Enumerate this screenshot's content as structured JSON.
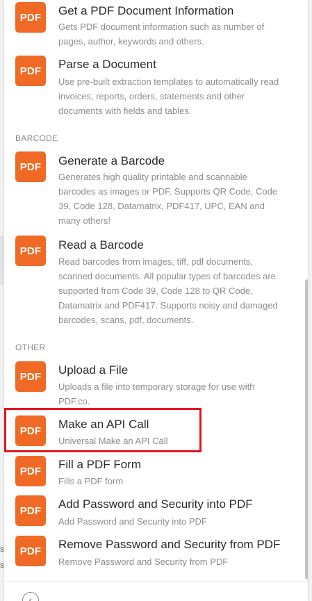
{
  "icon_label": "PDF",
  "colors": {
    "accent": "#f06a25",
    "highlight": "#e3141e"
  },
  "sections": {
    "barcode": "BARCODE",
    "other": "OTHER"
  },
  "items": [
    {
      "title": "Get a PDF Document Information",
      "description": "Gets PDF document information such as number of pages, author, keywords and others."
    },
    {
      "title": "Parse a Document",
      "description": "Use pre-built extraction templates to automatically read invoices, reports, orders, statements and other documents with fields and tables."
    },
    {
      "title": "Generate a Barcode",
      "description": "Generates high quality printable and scannable barcodes as images or PDF. Supports QR Code, Code 39, Code 128, Datamatrix, PDF417, UPC, EAN and many others!"
    },
    {
      "title": "Read a Barcode",
      "description": "Read barcodes from images, tiff, pdf documents, scanned documents. All popular types of barcodes are supported from Code 39, Code 128 to QR Code, Datamatrix and PDF417. Supports noisy and damaged barcodes, scans, pdf, documents."
    },
    {
      "title": "Upload a File",
      "description": "Uploads a file into temporary storage for use with PDF.co."
    },
    {
      "title": "Make an API Call",
      "description": "Universal Make an API Call"
    },
    {
      "title": "Fill a PDF Form",
      "description": "Fills a PDF form"
    },
    {
      "title": "Add Password and Security into PDF",
      "description": "Add Password and Security into PDF"
    },
    {
      "title": "Remove Password and Security from PDF",
      "description": "Remove Password and Security from PDF"
    }
  ],
  "edge_text": {
    "line1": "s",
    "line2": "s"
  },
  "footer": {
    "back_icon": "arrow-left-icon",
    "input_value": ""
  }
}
